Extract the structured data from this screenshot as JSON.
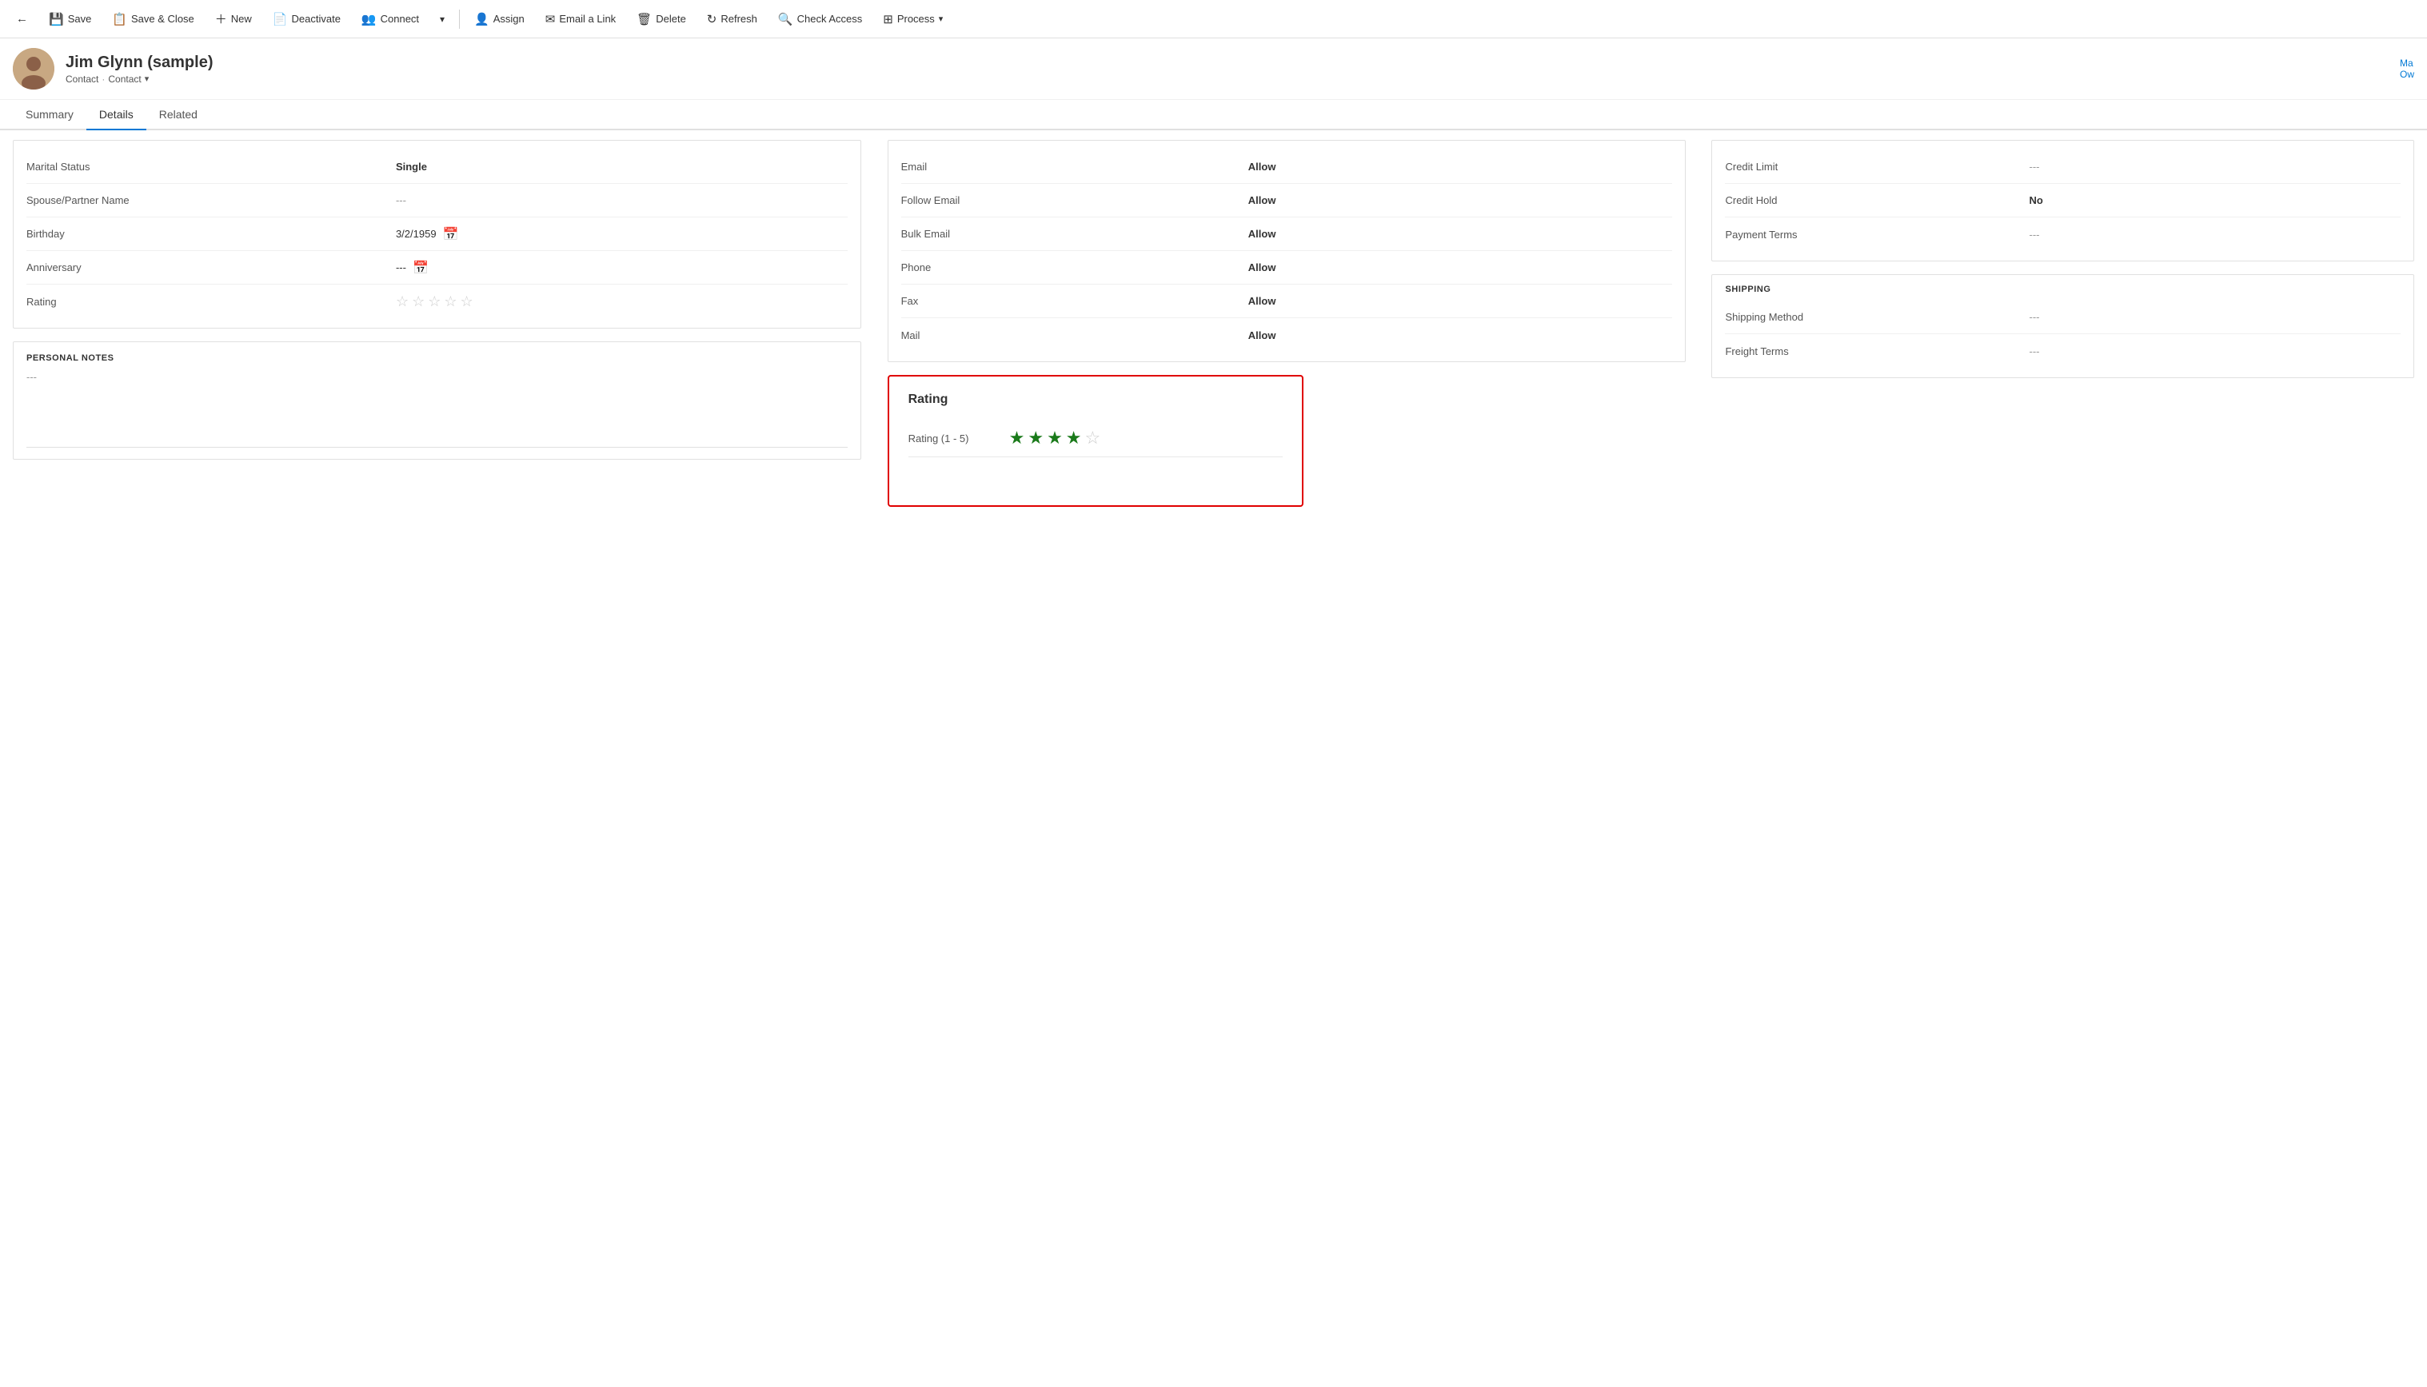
{
  "toolbar": {
    "back_icon": "←",
    "save_label": "Save",
    "save_close_label": "Save & Close",
    "new_label": "New",
    "deactivate_label": "Deactivate",
    "connect_label": "Connect",
    "dropdown_label": "▾",
    "assign_label": "Assign",
    "email_link_label": "Email a Link",
    "delete_label": "Delete",
    "refresh_label": "Refresh",
    "check_access_label": "Check Access",
    "process_label": "Process",
    "process_dropdown": "▾"
  },
  "header": {
    "title": "Jim Glynn (sample)",
    "subtitle_type": "Contact",
    "subtitle_entity": "Contact",
    "header_right_line1": "Ma",
    "header_right_line2": "Ow"
  },
  "tabs": [
    {
      "id": "summary",
      "label": "Summary",
      "active": false
    },
    {
      "id": "details",
      "label": "Details",
      "active": true
    },
    {
      "id": "related",
      "label": "Related",
      "active": false
    }
  ],
  "personal_info": {
    "marital_status_label": "Marital Status",
    "marital_status_value": "Single",
    "spouse_label": "Spouse/Partner Name",
    "spouse_value": "---",
    "birthday_label": "Birthday",
    "birthday_value": "3/2/1959",
    "anniversary_label": "Anniversary",
    "anniversary_value": "---",
    "rating_label": "Rating",
    "stars_empty": [
      "☆",
      "☆",
      "☆",
      "☆",
      "☆"
    ]
  },
  "personal_notes": {
    "title": "PERSONAL NOTES",
    "value": "---"
  },
  "contact_preferences": {
    "email_label": "Email",
    "email_value": "Allow",
    "follow_email_label": "Follow Email",
    "follow_email_value": "Allow",
    "bulk_email_label": "Bulk Email",
    "bulk_email_value": "Allow",
    "phone_label": "Phone",
    "phone_value": "Allow",
    "fax_label": "Fax",
    "fax_value": "Allow",
    "mail_label": "Mail",
    "mail_value": "Allow"
  },
  "billing": {
    "credit_limit_label": "Credit Limit",
    "credit_limit_value": "---",
    "credit_hold_label": "Credit Hold",
    "credit_hold_value": "No",
    "payment_terms_label": "Payment Terms",
    "payment_terms_value": "---"
  },
  "shipping": {
    "section_title": "SHIPPING",
    "shipping_method_label": "Shipping Method",
    "shipping_method_value": "---",
    "freight_terms_label": "Freight Terms",
    "freight_terms_value": "---"
  },
  "rating_popup": {
    "title": "Rating",
    "label": "Rating (1 - 5)",
    "filled_stars": 4,
    "total_stars": 5
  }
}
